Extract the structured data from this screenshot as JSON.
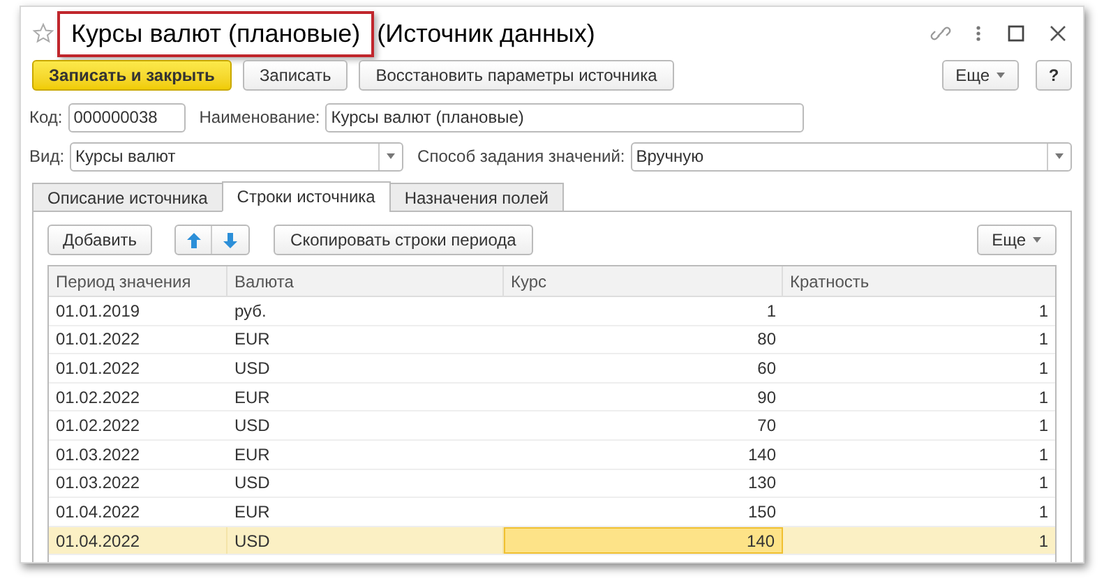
{
  "window": {
    "title": "Курсы валют (плановые)",
    "title_suffix": "(Источник данных)",
    "title_highlighted": true
  },
  "command_bar": {
    "buttons": [
      {
        "label": "Записать и закрыть",
        "kind": "primary"
      },
      {
        "label": "Записать",
        "kind": "normal"
      },
      {
        "label": "Восстановить параметры источника",
        "kind": "normal"
      }
    ],
    "more": "Еще",
    "help": "?"
  },
  "fields": {
    "code": {
      "label": "Код:",
      "value": "000000038"
    },
    "name": {
      "label": "Наименование:",
      "value": "Курсы валют (плановые)"
    },
    "kind": {
      "label": "Вид:",
      "value": "Курсы валют"
    },
    "method": {
      "label": "Способ задания значений:",
      "value": "Вручную"
    }
  },
  "tabs": [
    {
      "label": "Описание источника",
      "selected": false
    },
    {
      "label": "Строки источника",
      "selected": true
    },
    {
      "label": "Назначения полей",
      "selected": false
    }
  ],
  "table_toolbar": {
    "add": "Добавить",
    "copy": "Скопировать строки периода",
    "more": "Еще"
  },
  "table": {
    "columns": [
      "Период значения",
      "Валюта",
      "Курс",
      "Кратность"
    ],
    "rows": [
      {
        "cells": [
          "01.01.2019",
          "руб.",
          "1",
          "1"
        ],
        "selected": false
      },
      {
        "cells": [
          "01.01.2022",
          "EUR",
          "80",
          "1"
        ],
        "selected": false
      },
      {
        "cells": [
          "01.01.2022",
          "USD",
          "60",
          "1"
        ],
        "selected": false
      },
      {
        "cells": [
          "01.02.2022",
          "EUR",
          "90",
          "1"
        ],
        "selected": false
      },
      {
        "cells": [
          "01.02.2022",
          "USD",
          "70",
          "1"
        ],
        "selected": false
      },
      {
        "cells": [
          "01.03.2022",
          "EUR",
          "140",
          "1"
        ],
        "selected": false
      },
      {
        "cells": [
          "01.03.2022",
          "USD",
          "130",
          "1"
        ],
        "selected": false
      },
      {
        "cells": [
          "01.04.2022",
          "EUR",
          "150",
          "1"
        ],
        "selected": false
      },
      {
        "cells": [
          "01.04.2022",
          "USD",
          "140",
          "1"
        ],
        "selected": true
      }
    ]
  }
}
